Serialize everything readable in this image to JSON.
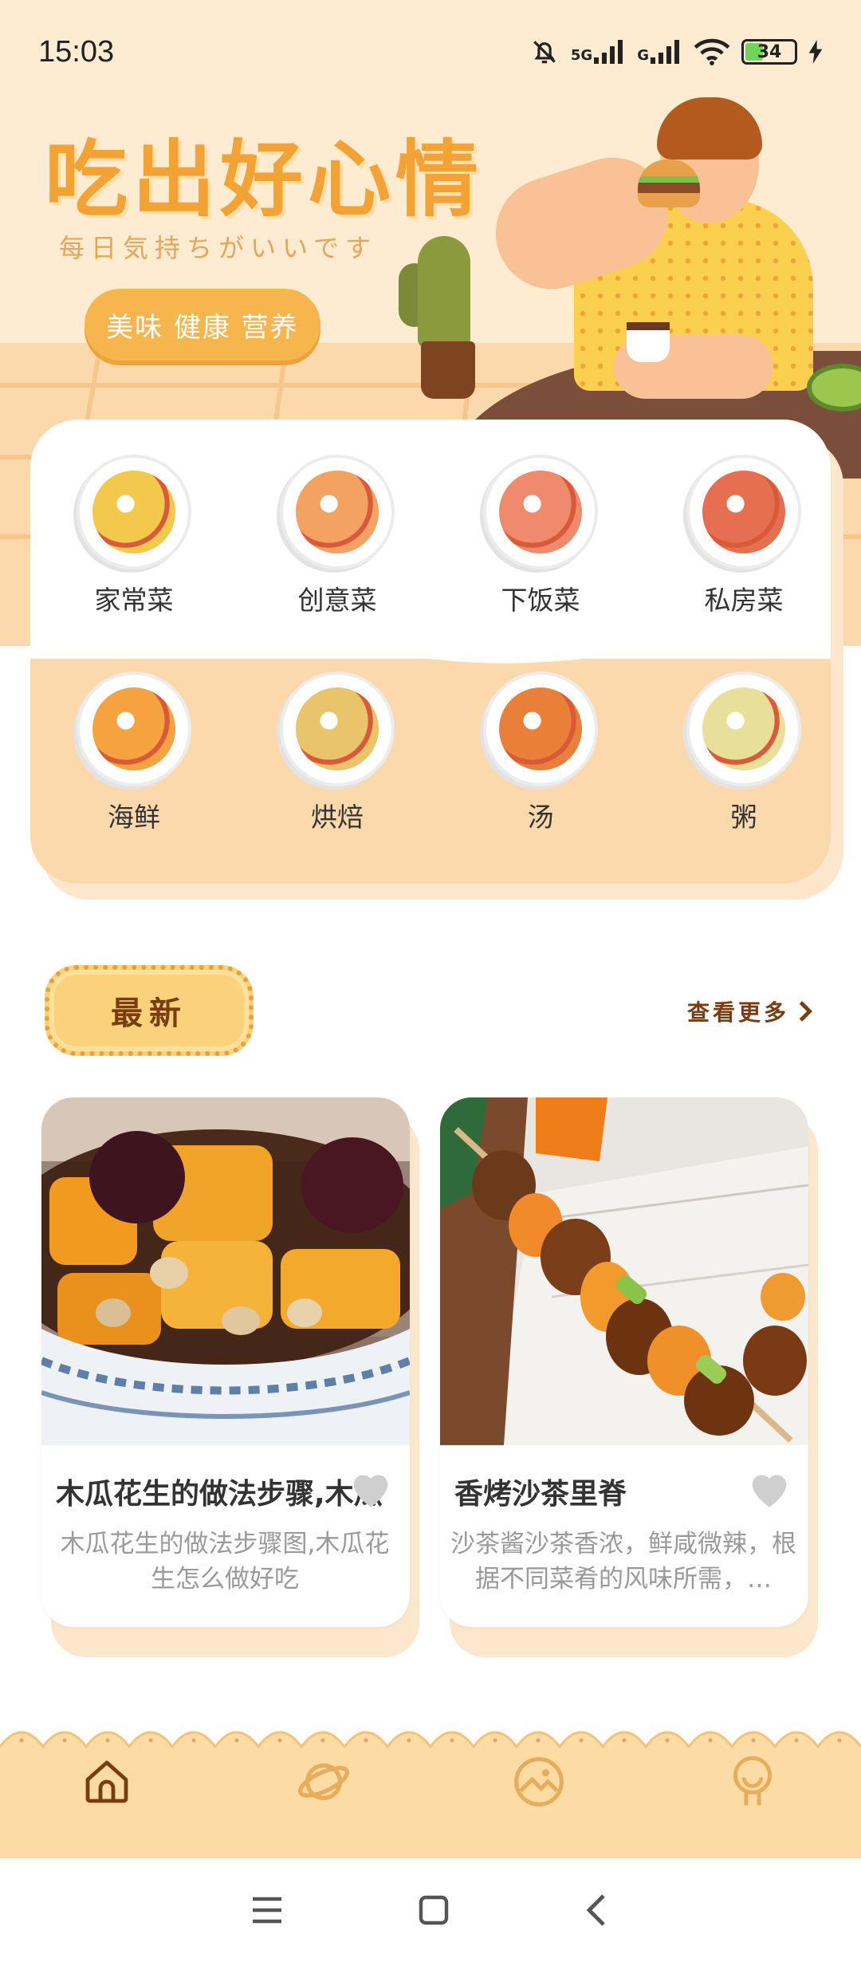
{
  "status_bar": {
    "time": "15:03",
    "network_1": "5G",
    "network_2": "G",
    "battery": "34"
  },
  "hero": {
    "title": "吃出好心情",
    "subtitle": "每日気持ちがいいです",
    "pill_label": "美味 健康 营养"
  },
  "categories": [
    {
      "label": "家常菜",
      "icon": "salad-plate-icon",
      "color": "#f2c94c"
    },
    {
      "label": "创意菜",
      "icon": "avocado-plate-icon",
      "color": "#f4a261"
    },
    {
      "label": "下饭菜",
      "icon": "salmon-plate-icon",
      "color": "#f08a6c"
    },
    {
      "label": "私房菜",
      "icon": "grilled-meat-plate-icon",
      "color": "#e76f51"
    },
    {
      "label": "海鲜",
      "icon": "seafood-plate-icon",
      "color": "#f4a340"
    },
    {
      "label": "烘焙",
      "icon": "crepe-plate-icon",
      "color": "#e9c46a"
    },
    {
      "label": "汤",
      "icon": "soup-pot-icon",
      "color": "#e9803a"
    },
    {
      "label": "粥",
      "icon": "porridge-bowl-icon",
      "color": "#e8df9a"
    }
  ],
  "latest": {
    "badge": "最新",
    "see_more": "查看更多"
  },
  "recipes": [
    {
      "title": "木瓜花生的做法步骤,木瓜",
      "description": "木瓜花生的做法步骤图,木瓜花生怎么做好吃"
    },
    {
      "title": "香烤沙茶里脊",
      "description": "沙茶酱沙茶香浓，鲜咸微辣，根据不同菜肴的风味所需，…"
    }
  ],
  "tabbar": {
    "items": [
      {
        "icon": "home-icon",
        "active": true
      },
      {
        "icon": "planet-icon",
        "active": false
      },
      {
        "icon": "picture-icon",
        "active": false
      },
      {
        "icon": "profile-icon",
        "active": false
      }
    ]
  },
  "colors": {
    "accent": "#f3a236",
    "peach": "#fcd9ad",
    "brown": "#7a3d12"
  }
}
